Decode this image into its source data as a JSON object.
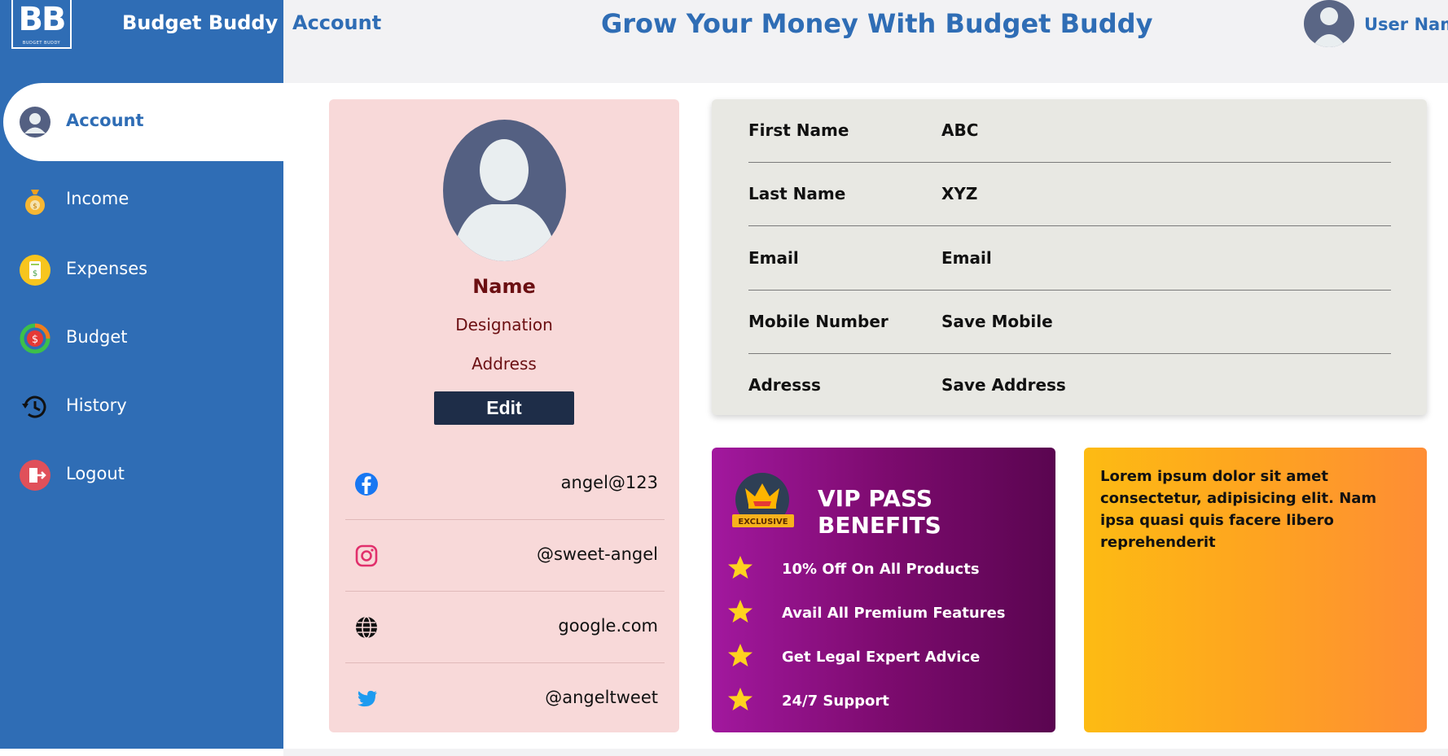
{
  "brand": {
    "logo_text": "BB",
    "logo_sub": "BUDGET BUDDY",
    "name": "Budget Buddy"
  },
  "header": {
    "section": "Account",
    "title": "Grow Your Money With Budget Buddy",
    "user": "User Name"
  },
  "sidebar": {
    "items": [
      {
        "label": "Account",
        "icon": "user-avatar-icon",
        "active": true
      },
      {
        "label": "Income",
        "icon": "money-bag-icon"
      },
      {
        "label": "Expenses",
        "icon": "receipt-icon"
      },
      {
        "label": "Budget",
        "icon": "budget-dollar-icon"
      },
      {
        "label": "History",
        "icon": "history-clock-icon"
      },
      {
        "label": "Logout",
        "icon": "logout-door-icon"
      }
    ]
  },
  "profile": {
    "name": "Name",
    "designation": "Designation",
    "address": "Address",
    "edit_label": "Edit",
    "social": [
      {
        "icon": "facebook-icon",
        "value": "angel@123"
      },
      {
        "icon": "instagram-icon",
        "value": "@sweet-angel"
      },
      {
        "icon": "globe-icon",
        "value": "google.com"
      },
      {
        "icon": "twitter-icon",
        "value": "@angeltweet"
      }
    ]
  },
  "details": {
    "rows": [
      {
        "key": "First Name",
        "value": "ABC"
      },
      {
        "key": "Last Name",
        "value": "XYZ"
      },
      {
        "key": "Email",
        "value": "Email"
      },
      {
        "key": "Mobile Number",
        "value": "Save Mobile"
      },
      {
        "key": "Adresss",
        "value": "Save Address"
      }
    ]
  },
  "vip": {
    "badge_text": "EXCLUSIVE",
    "title": "VIP PASS BENEFITS",
    "benefits": [
      "10% Off On All Products",
      "Avail All Premium Features",
      "Get Legal Expert Advice",
      "24/7 Support"
    ]
  },
  "promo": {
    "text": "Lorem ipsum dolor sit amet consectetur, adipisicing elit. Nam ipsa quasi quis facere libero reprehenderit"
  },
  "colors": {
    "primary": "#2f6db5",
    "card_pink": "#f8d9d9",
    "dark_red": "#6b0f12",
    "vip_purple": "#8e1488",
    "orange": "#fea420"
  }
}
